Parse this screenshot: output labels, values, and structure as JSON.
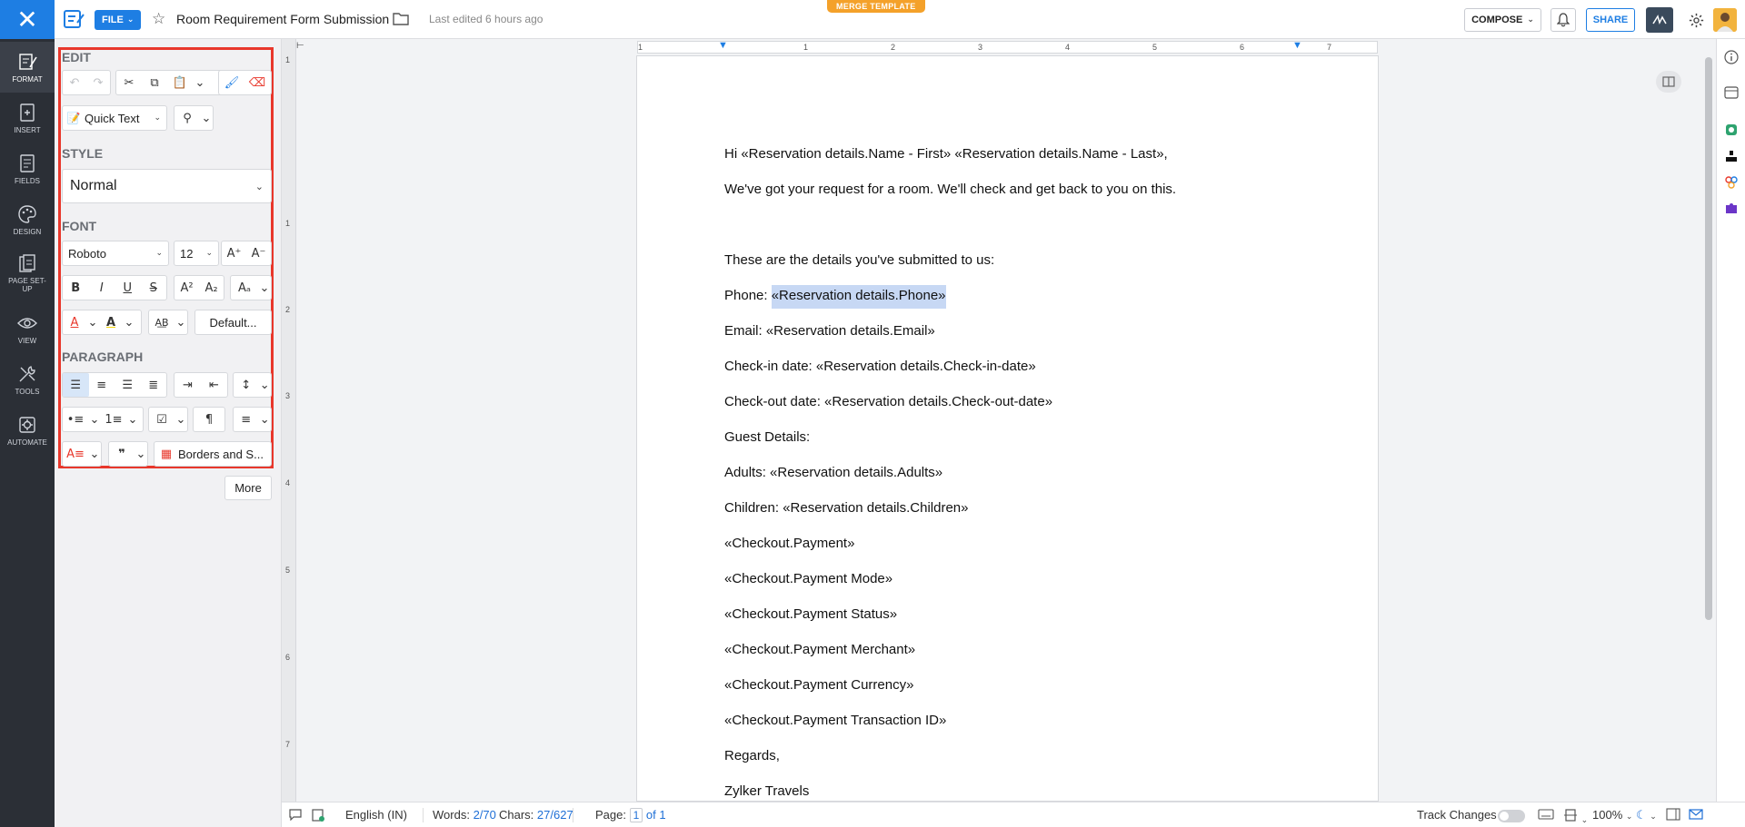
{
  "topbar": {
    "file_label": "FILE",
    "doc_title": "Room Requirement Form Submission",
    "last_edited": "Last edited 6 hours ago",
    "merge_badge": "MERGE TEMPLATE",
    "compose_label": "COMPOSE",
    "share_label": "SHARE"
  },
  "rail": {
    "items": [
      {
        "label": "FORMAT",
        "icon": "format-icon"
      },
      {
        "label": "INSERT",
        "icon": "insert-icon"
      },
      {
        "label": "FIELDS",
        "icon": "fields-icon"
      },
      {
        "label": "DESIGN",
        "icon": "palette-icon"
      },
      {
        "label": "PAGE SET-UP",
        "icon": "page-setup-icon"
      },
      {
        "label": "VIEW",
        "icon": "eye-icon"
      },
      {
        "label": "TOOLS",
        "icon": "tools-icon"
      },
      {
        "label": "AUTOMATE",
        "icon": "automate-icon"
      }
    ]
  },
  "panel": {
    "edit_title": "EDIT",
    "quick_text": "Quick Text",
    "style_title": "STYLE",
    "style_value": "Normal",
    "font_title": "FONT",
    "font_family": "Roboto",
    "font_size": "12",
    "default_label": "Default...",
    "paragraph_title": "PARAGRAPH",
    "borders_label": "Borders and S...",
    "more_label": "More"
  },
  "ruler": {
    "h_numbers": [
      "1",
      "1",
      "2",
      "3",
      "4",
      "5",
      "6",
      "7"
    ],
    "v_numbers": [
      "1",
      "1",
      "2",
      "3",
      "4",
      "5",
      "6",
      "7"
    ]
  },
  "document": {
    "lines": [
      "Hi «Reservation details.Name - First» «Reservation details.Name - Last»,",
      "We've got your request for a room. We'll check and get back to you on this.",
      "These are the details you've submitted to us:",
      "Phone: ",
      "Email: «Reservation details.Email»",
      "Check-in date: «Reservation details.Check-in-date»",
      "Check-out date: «Reservation details.Check-out-date»",
      "Guest Details:",
      "Adults: «Reservation details.Adults»",
      "Children: «Reservation details.Children»",
      "«Checkout.Payment»",
      "«Checkout.Payment Mode»",
      "«Checkout.Payment Status»",
      "«Checkout.Payment Merchant»",
      "«Checkout.Payment Currency»",
      "«Checkout.Payment Transaction ID»",
      "Regards,",
      "Zylker Travels"
    ],
    "selected_field": "«Reservation details.Phone»"
  },
  "statusbar": {
    "language": "English (IN)",
    "words_label": "Words:",
    "words_value": "2/70",
    "chars_label": "Chars:",
    "chars_value": "27/627",
    "page_label": "Page:",
    "page_current": "1",
    "page_total": "of 1",
    "track_changes": "Track Changes",
    "zoom": "100%"
  },
  "colors": {
    "accent": "#1e7ee3",
    "rail_bg": "#2b2f36",
    "highlight": "#c7d8f4",
    "panel_frame": "#e8372b",
    "merge_badge": "#f4a12a"
  }
}
